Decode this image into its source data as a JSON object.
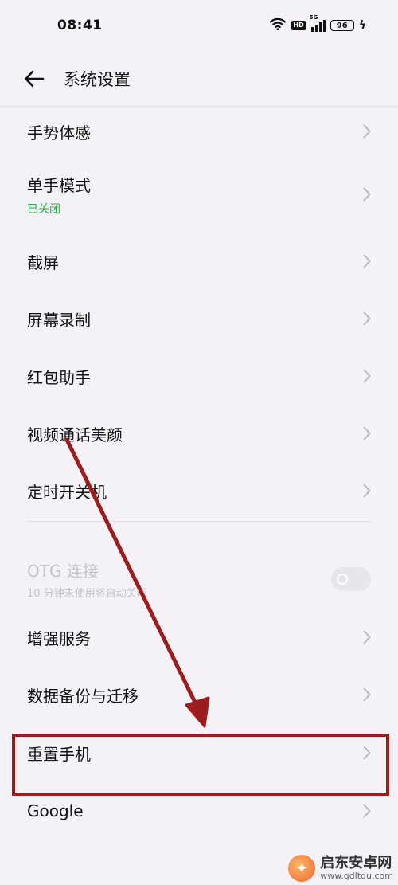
{
  "status_bar": {
    "time": "08:41",
    "hd_badge": "HD",
    "network": "5G",
    "battery": "96",
    "icons": [
      "wifi-icon",
      "hd-icon",
      "signal-icon",
      "battery-icon",
      "charging-icon"
    ]
  },
  "header": {
    "back_icon": "back-arrow-icon",
    "title": "系统设置"
  },
  "items": [
    {
      "label": "手势体感"
    },
    {
      "label": "单手模式",
      "sub": "已关闭"
    },
    {
      "label": "截屏"
    },
    {
      "label": "屏幕录制"
    },
    {
      "label": "红包助手"
    },
    {
      "label": "视频通话美颜"
    },
    {
      "label": "定时开关机"
    },
    {
      "label": "OTG 连接",
      "sub": "10 分钟未使用将自动关闭",
      "toggle_on": false
    },
    {
      "label": "增强服务"
    },
    {
      "label": "数据备份与迁移"
    },
    {
      "label": "重置手机"
    },
    {
      "label": "Google"
    }
  ],
  "colors": {
    "background": "#f4f2f7",
    "sub_green": "#2fa84f",
    "disabled_text": "#c4c2c9",
    "annotation_red": "#9b1d1d"
  },
  "annotation": {
    "highlighted_item": "重置手机"
  },
  "watermark": {
    "name": "启东安卓网",
    "url": "www.qdltdu.com"
  }
}
